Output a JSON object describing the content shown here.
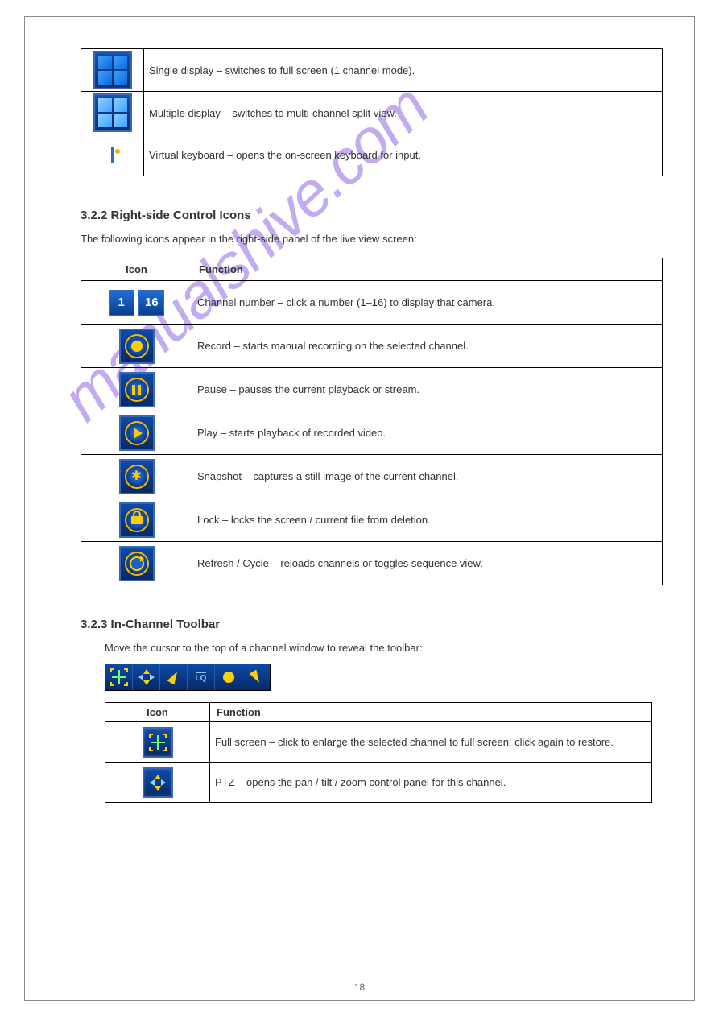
{
  "watermark": "manualshive.com",
  "table1": {
    "rows": [
      {
        "desc": "Single display – switches to full screen (1 channel mode)."
      },
      {
        "desc": "Multiple display – switches to multi-channel split view."
      },
      {
        "desc": "Virtual keyboard – opens the on-screen keyboard for input."
      }
    ]
  },
  "section2": {
    "title": "3.2.2 Right-side Control Icons",
    "text": "The following icons appear in the right-side panel of the live view screen:",
    "headers": {
      "icon": "Icon",
      "func": "Function"
    },
    "rows": [
      {
        "num1": "1",
        "num2": "16",
        "desc": "Channel number – click a number (1–16) to display that camera."
      },
      {
        "desc": "Record – starts manual recording on the selected channel."
      },
      {
        "desc": "Pause – pauses the current playback or stream."
      },
      {
        "desc": "Play – starts playback of recorded video."
      },
      {
        "desc": "Snapshot – captures a still image of the current channel."
      },
      {
        "desc": "Lock – locks the screen / current file from deletion."
      },
      {
        "desc": "Refresh / Cycle – reloads channels or toggles sequence view."
      }
    ]
  },
  "section3": {
    "title": "3.2.3 In-Channel Toolbar",
    "lead": "Move the cursor to the top of a channel window to reveal the toolbar:",
    "headers": {
      "icon": "Icon",
      "func": "Function"
    },
    "rows": [
      {
        "desc": "Full screen – click to enlarge the selected channel to full screen; click again to restore."
      },
      {
        "desc": "PTZ – opens the pan / tilt / zoom control panel for this channel."
      }
    ],
    "toolbar_lq": "LQ"
  },
  "page_number": "18"
}
